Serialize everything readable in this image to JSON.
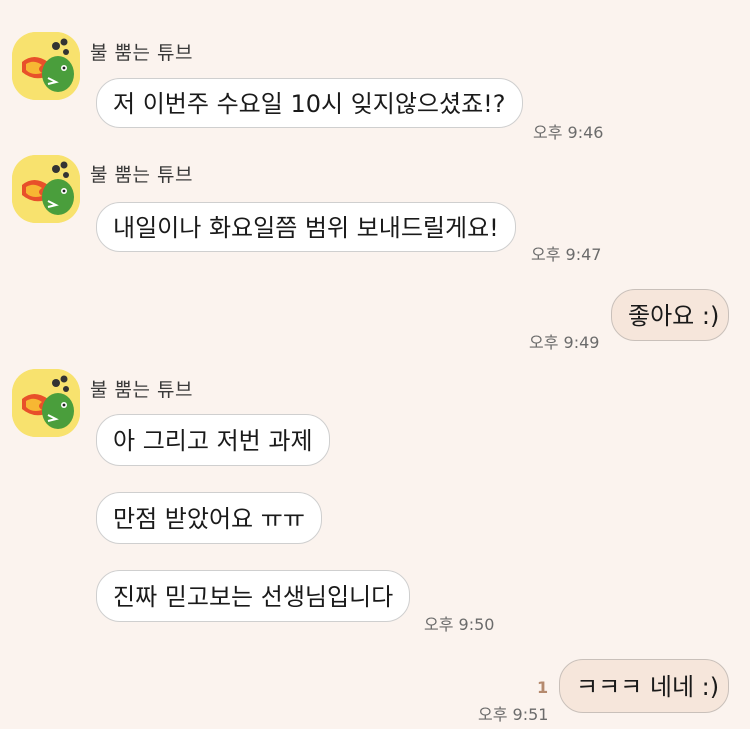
{
  "sender_name": "불 뿜는 튜브",
  "messages": [
    {
      "text": "저 이번주 수요일 10시 잊지않으셨죠!?",
      "time": "오후 9:46"
    },
    {
      "text": "내일이나 화요일쯤 범위 보내드릴게요!",
      "time": "오후 9:47"
    },
    {
      "text": "좋아요 :)",
      "time": "오후 9:49"
    },
    {
      "text": "아 그리고 저번 과제"
    },
    {
      "text": "만점 받았어요 ㅠㅠ"
    },
    {
      "text": "진짜 믿고보는 선생님입니다",
      "time": "오후 9:50"
    },
    {
      "text": "ㅋㅋㅋ 네네 :)",
      "time": "오후 9:51",
      "unread": "1"
    }
  ],
  "colors": {
    "background": "#fbf3ee",
    "received_bubble": "#ffffff",
    "sent_bubble": "#f6e6db",
    "avatar_bg": "#f8e26e"
  }
}
